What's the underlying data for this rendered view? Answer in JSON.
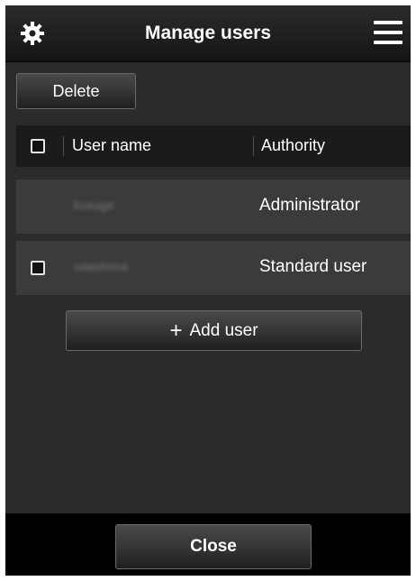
{
  "header": {
    "title": "Manage users",
    "settings_icon": "gear-icon",
    "menu_icon": "hamburger-menu-icon"
  },
  "toolbar": {
    "delete_label": "Delete"
  },
  "table": {
    "columns": [
      "User name",
      "Authority"
    ],
    "rows": [
      {
        "user_name": "kosuge",
        "authority": "Administrator",
        "has_checkbox": false
      },
      {
        "user_name": "odashima",
        "authority": "Standard user",
        "has_checkbox": true
      }
    ]
  },
  "add_user": {
    "icon": "plus-icon",
    "label": "Add user"
  },
  "footer": {
    "close_label": "Close"
  }
}
